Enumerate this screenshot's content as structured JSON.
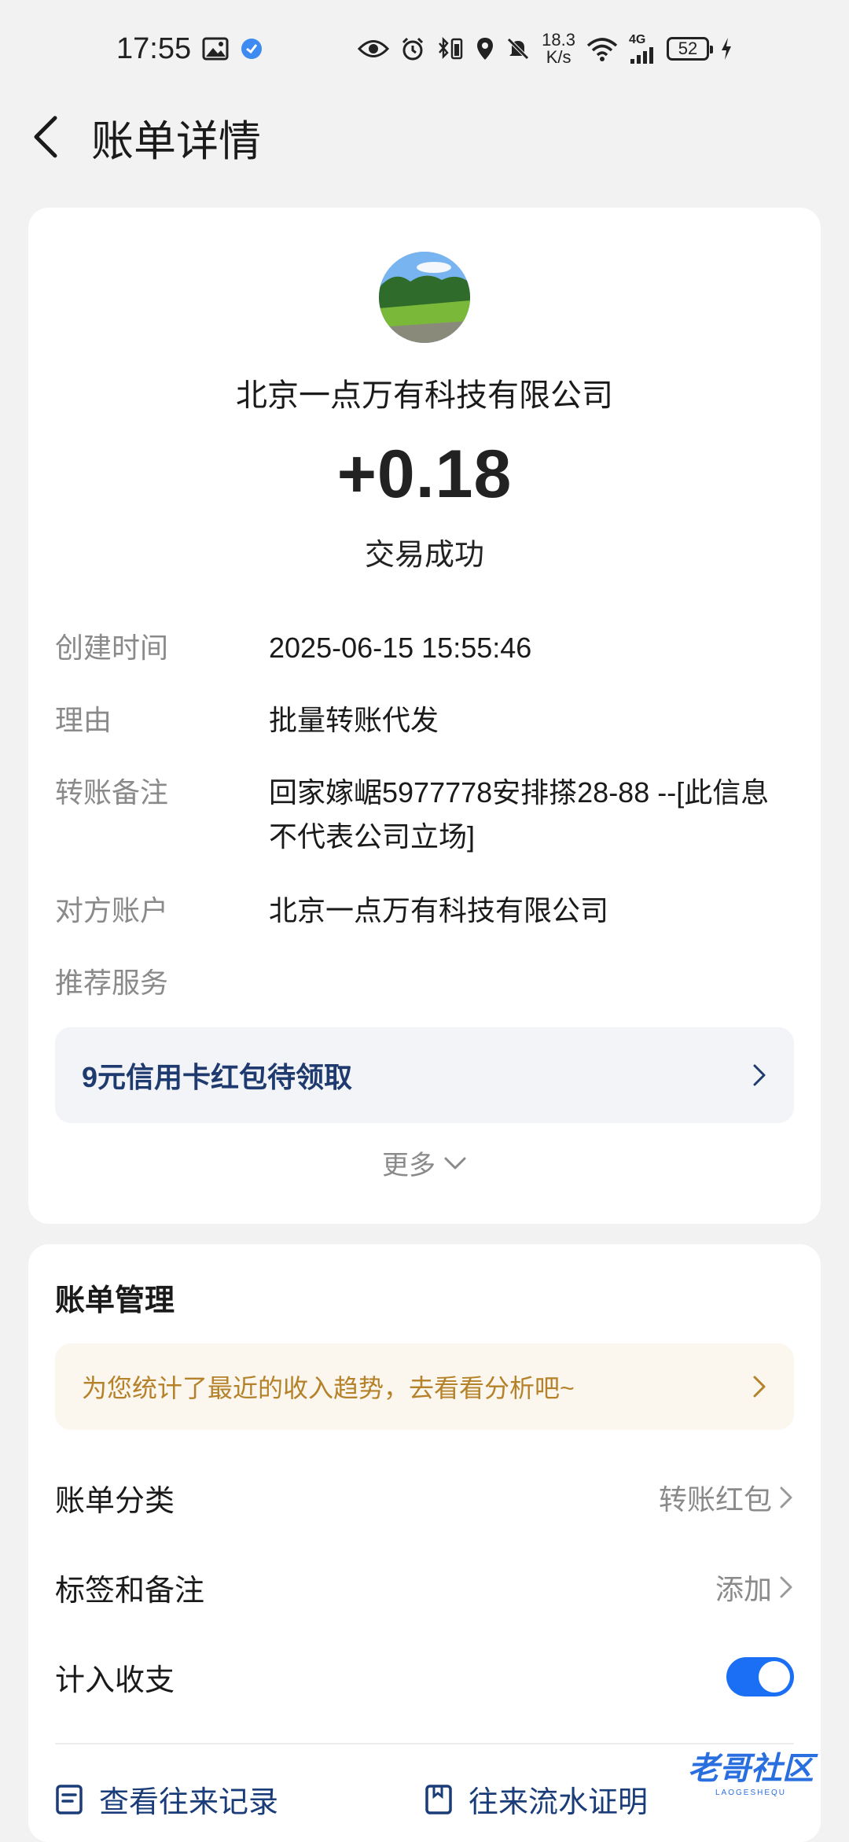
{
  "status_bar": {
    "time": "17:55",
    "speed_value": "18.3",
    "speed_unit": "K/s",
    "network": "4G",
    "battery": "52"
  },
  "nav": {
    "title": "账单详情"
  },
  "transaction": {
    "merchant": "北京一点万有科技有限公司",
    "amount": "+0.18",
    "status": "交易成功",
    "details": [
      {
        "label": "创建时间",
        "value": "2025-06-15 15:55:46"
      },
      {
        "label": "理由",
        "value": "批量转账代发"
      },
      {
        "label": "转账备注",
        "value": "回家嫁崌5977778安排搽28-88 --[此信息不代表公司立场]"
      },
      {
        "label": "对方账户",
        "value": "北京一点万有科技有限公司"
      },
      {
        "label": "推荐服务",
        "value": ""
      }
    ],
    "promo": "9元信用卡红包待领取",
    "more": "更多"
  },
  "manage": {
    "title": "账单管理",
    "insight": "为您统计了最近的收入趋势，去看看分析吧~",
    "category_label": "账单分类",
    "category_value": "转账红包",
    "tags_label": "标签和备注",
    "tags_value": "添加",
    "include_label": "计入收支",
    "include_enabled": true,
    "link_history": "查看往来记录",
    "link_proof": "往来流水证明"
  },
  "watermark": {
    "main": "老哥社区",
    "sub": "LAOGESHEQU"
  },
  "colors": {
    "accent": "#1a6ff5",
    "promo_text": "#1f3a6e",
    "insight_text": "#b5822a",
    "background": "#f2f2f2"
  }
}
